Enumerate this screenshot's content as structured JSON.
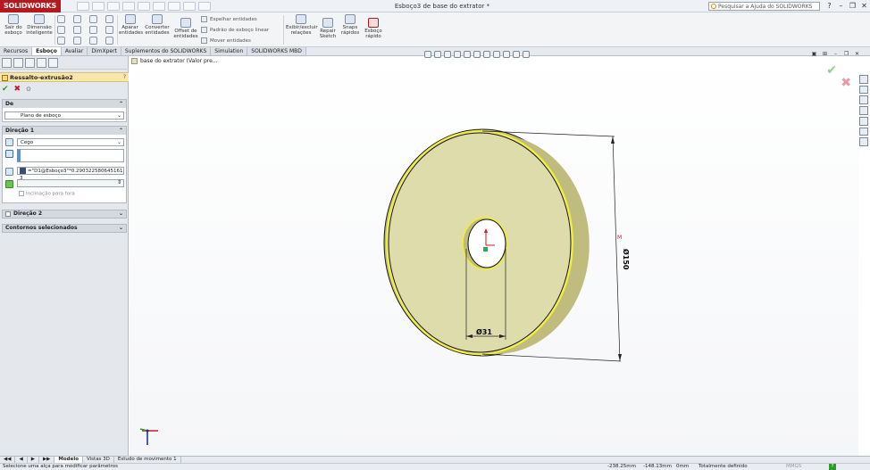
{
  "app": {
    "brand": "SOLIDWORKS",
    "doc_title": "Esboço3 de base do extrator *"
  },
  "search": {
    "placeholder": "Pesquisar a Ajuda do SOLIDWORKS"
  },
  "ribbon": {
    "exit_sketch": "Sair do esboço",
    "smart_dim": "Dimensão inteligente",
    "trim": "Aparar entidades",
    "convert": "Converter entidades",
    "offset": "Offset de entidades",
    "mirror": "Espelhar entidades",
    "linear_pattern": "Padrão de esboço linear",
    "move": "Mover entidades",
    "display_relations": "Exibir/excluir relações",
    "repair": "Repair Sketch",
    "snaps": "Snaps rápidos",
    "rapid_sketch": "Esboço rápido"
  },
  "tabs": [
    "Recursos",
    "Esboço",
    "Avaliar",
    "DimXpert",
    "Suplementos do SOLIDWORKS",
    "Simulation",
    "SOLIDWORKS MBD"
  ],
  "active_tab": "Esboço",
  "property_manager": {
    "title": "Ressalto-extrusão2",
    "ok": "✔",
    "cancel": "✖",
    "from": {
      "label": "De",
      "value": "Plano de esboço"
    },
    "direction1": {
      "label": "Direção 1",
      "end_condition": "Cego",
      "depth_value": "=\"D1@Esboço3\"*0.290322580645161 3",
      "draft_label": "Inclinação para fora"
    },
    "direction2": {
      "label": "Direção 2"
    },
    "selected_contours": {
      "label": "Contornos selecionados"
    }
  },
  "tree": {
    "item": "base do extrator  (Valor pre..."
  },
  "dimensions": {
    "outer": "Ø150",
    "inner": "Ø31"
  },
  "bottom_tabs": [
    "Modelo",
    "Vistas 3D",
    "Estudo de movimento 1"
  ],
  "active_bottom_tab": "Modelo",
  "status": {
    "message": "Selecione uma alça para modificar parâmetros",
    "x": "-238.25mm",
    "y": "-148.13mm",
    "z": "0mm",
    "state": "Totalmente definido",
    "units": "MMGS"
  },
  "colors": {
    "brand": "#b5191f",
    "part_face": "#dedcaa",
    "part_edge": "#bfbc7e",
    "highlight": "#f2ef36"
  }
}
